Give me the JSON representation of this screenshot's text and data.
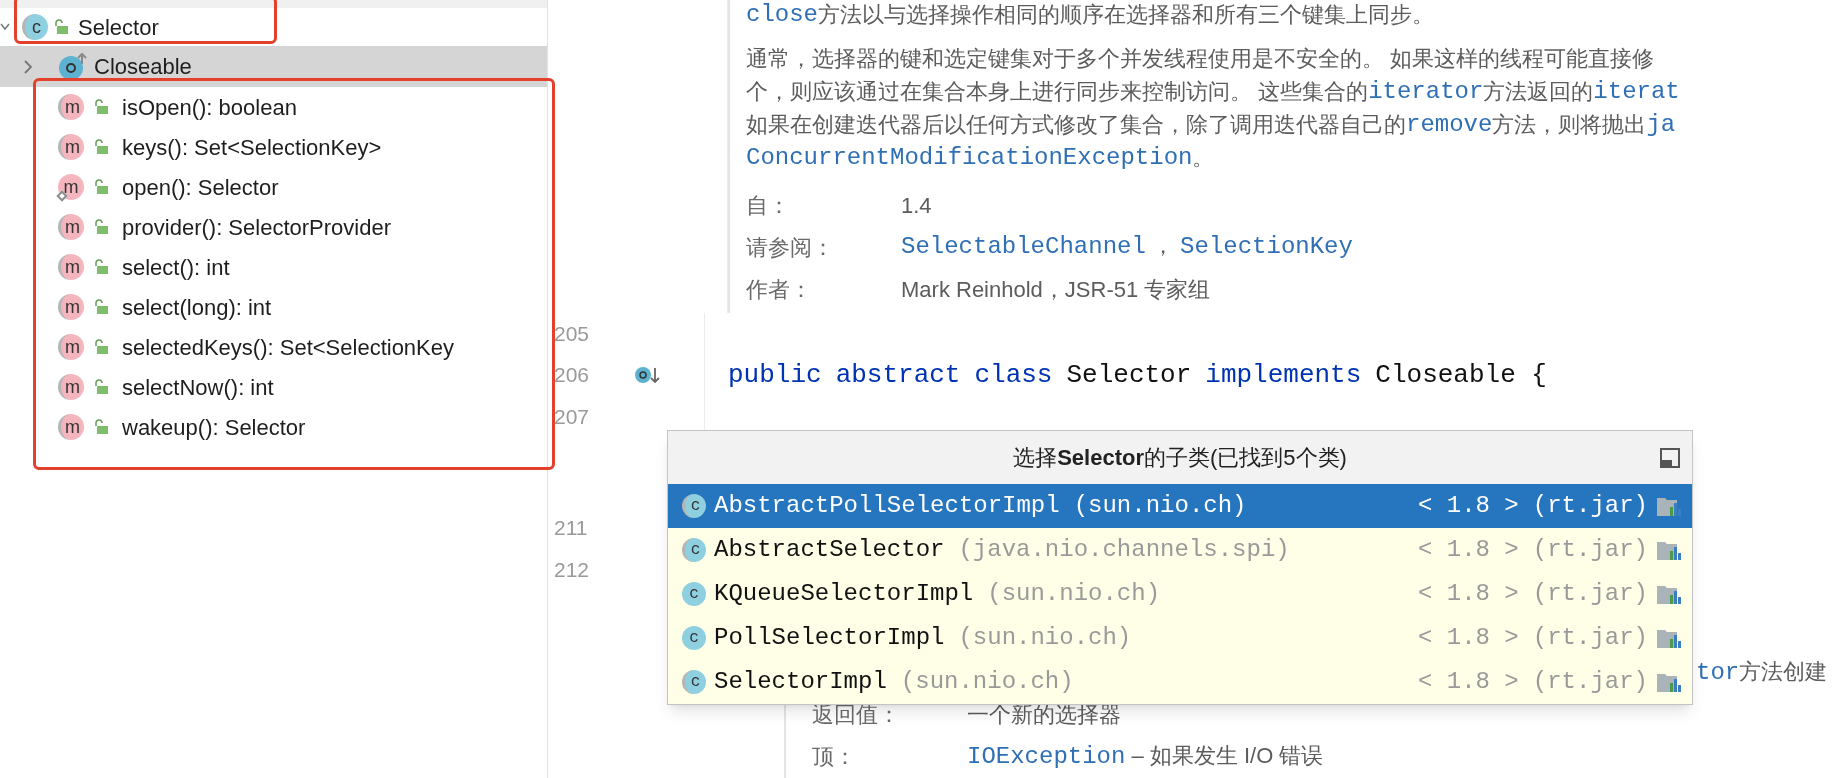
{
  "structure": {
    "root": {
      "label": "Selector",
      "badge": "c",
      "abstract": true,
      "expanded": true,
      "selected": false,
      "children": [
        {
          "label": "Closeable",
          "kind": "interface",
          "expanded": false,
          "selected": true
        },
        {
          "label": "isOpen(): boolean",
          "kind": "method",
          "badge": "m",
          "abstract": true,
          "static": false,
          "selected": false
        },
        {
          "label": "keys(): Set<SelectionKey>",
          "kind": "method",
          "badge": "m",
          "abstract": true,
          "static": false,
          "selected": false
        },
        {
          "label": "open(): Selector",
          "kind": "method",
          "badge": "m",
          "abstract": false,
          "static": true,
          "selected": false
        },
        {
          "label": "provider(): SelectorProvider",
          "kind": "method",
          "badge": "m",
          "abstract": true,
          "static": false,
          "selected": false
        },
        {
          "label": "select(): int",
          "kind": "method",
          "badge": "m",
          "abstract": true,
          "static": false,
          "selected": false
        },
        {
          "label": "select(long): int",
          "kind": "method",
          "badge": "m",
          "abstract": true,
          "static": false,
          "selected": false
        },
        {
          "label": "selectedKeys(): Set<SelectionKey",
          "kind": "method",
          "badge": "m",
          "abstract": true,
          "static": false,
          "selected": false
        },
        {
          "label": "selectNow(): int",
          "kind": "method",
          "badge": "m",
          "abstract": true,
          "static": false,
          "selected": false
        },
        {
          "label": "wakeup(): Selector",
          "kind": "method",
          "badge": "m",
          "abstract": true,
          "static": false,
          "selected": false
        }
      ]
    }
  },
  "doc_top": {
    "paragraphs": [
      [
        {
          "kind": "code",
          "text": "close"
        },
        {
          "kind": "text",
          "text": "方法以与选择操作相同的顺序在选择器和所有三个键集上同步。"
        }
      ],
      [
        {
          "kind": "text",
          "text": "通常，选择器的键和选定键集对于多个并发线程使用是不安全的。 如果这样的线程可能直接修"
        }
      ],
      [
        {
          "kind": "text",
          "text": "个，则应该通过在集合本身上进行同步来控制访问。 这些集合的"
        },
        {
          "kind": "code",
          "text": "iterator"
        },
        {
          "kind": "text",
          "text": "方法返回的"
        },
        {
          "kind": "code",
          "text": "iterat"
        }
      ],
      [
        {
          "kind": "text",
          "text": "如果在创建迭代器后以任何方式修改了集合，除了调用迭代器自己的"
        },
        {
          "kind": "code",
          "text": "remove"
        },
        {
          "kind": "text",
          "text": "方法，则将抛出"
        },
        {
          "kind": "code",
          "text": "ja"
        }
      ],
      [
        {
          "kind": "code",
          "text": "ConcurrentModificationException"
        },
        {
          "kind": "text",
          "text": " 。"
        }
      ]
    ],
    "fields": [
      {
        "label": "自：",
        "values": [
          {
            "kind": "text",
            "text": "1.4"
          }
        ]
      },
      {
        "label": "请参阅：",
        "values": [
          {
            "kind": "code",
            "text": "SelectableChannel"
          },
          {
            "kind": "text",
            "text": " ， "
          },
          {
            "kind": "code",
            "text": "SelectionKey"
          }
        ]
      },
      {
        "label": "作者：",
        "values": [
          {
            "kind": "text",
            "text": "Mark Reinhold，JSR-51 专家组"
          }
        ]
      }
    ]
  },
  "code_lines": [
    {
      "number": "205"
    },
    {
      "number": "206",
      "marker": true,
      "tokens": [
        {
          "kind": "keyword",
          "text": "public"
        },
        {
          "kind": "keyword",
          "text": "abstract"
        },
        {
          "kind": "keyword",
          "text": "class"
        },
        {
          "kind": "plain",
          "text": "Selector"
        },
        {
          "kind": "keyword",
          "text": "implements"
        },
        {
          "kind": "plain",
          "text": "Closeable {"
        }
      ]
    },
    {
      "number": "207"
    },
    {
      "number": "211",
      "gap_before": true
    },
    {
      "number": "212"
    }
  ],
  "doc_bottom": {
    "fragment": [
      {
        "kind": "code",
        "text": "tor"
      },
      {
        "kind": "text",
        "text": "方法创建"
      }
    ],
    "fields": [
      {
        "label": "返回值：",
        "values": [
          {
            "kind": "text",
            "text": "一个新的选择器"
          }
        ]
      },
      {
        "label": "顶：",
        "values": [
          {
            "kind": "code",
            "text": "IOException"
          },
          {
            "kind": "text",
            "text": " – 如果发生 I/O 错误"
          }
        ]
      }
    ]
  },
  "popup": {
    "title": "选择**Selector**的子类(已找到5个类)",
    "items": [
      {
        "name": "AbstractPollSelectorImpl",
        "package": "(sun.nio.ch)",
        "version": "< 1.8 >",
        "jar": "(rt.jar)",
        "badge": "c",
        "abstract": true,
        "selected": true
      },
      {
        "name": "AbstractSelector",
        "package": "(java.nio.channels.spi)",
        "version": "< 1.8 >",
        "jar": "(rt.jar)",
        "badge": "c",
        "abstract": true,
        "selected": false
      },
      {
        "name": "KQueueSelectorImpl",
        "package": "(sun.nio.ch)",
        "version": "< 1.8 >",
        "jar": "(rt.jar)",
        "badge": "c",
        "abstract": false,
        "selected": false
      },
      {
        "name": "PollSelectorImpl",
        "package": "(sun.nio.ch)",
        "version": "< 1.8 >",
        "jar": "(rt.jar)",
        "badge": "c",
        "abstract": false,
        "selected": false
      },
      {
        "name": "SelectorImpl",
        "package": "(sun.nio.ch)",
        "version": "< 1.8 >",
        "jar": "(rt.jar)",
        "badge": "c",
        "abstract": true,
        "selected": false
      }
    ]
  }
}
